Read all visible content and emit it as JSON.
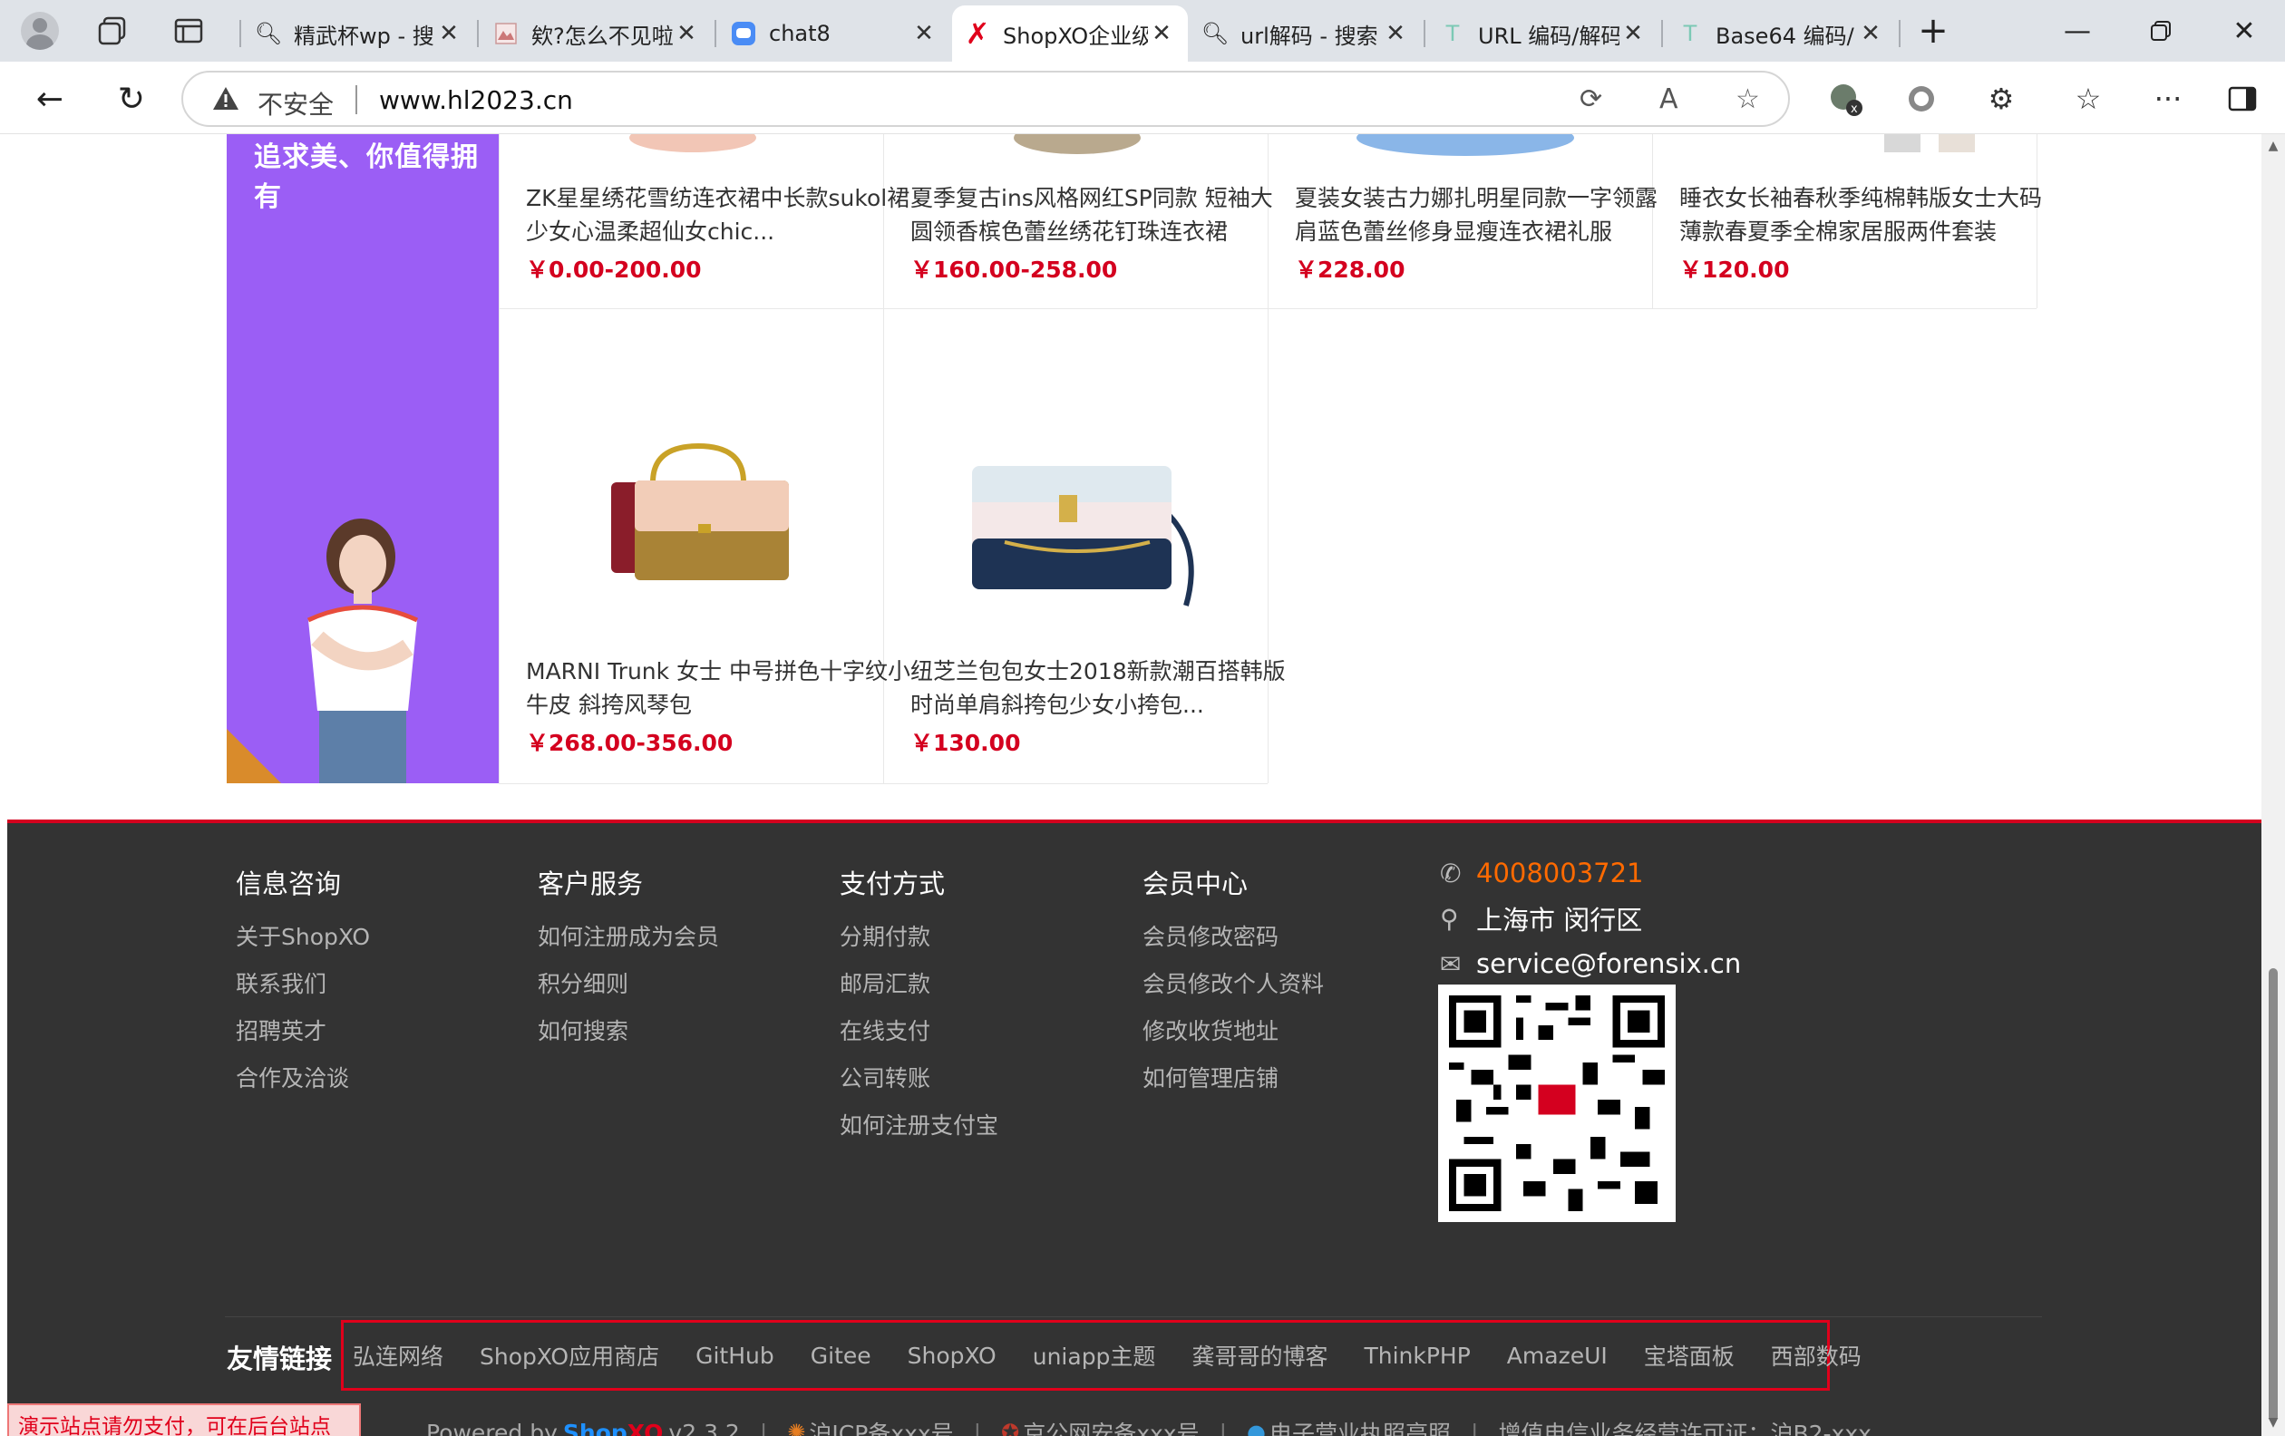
{
  "tabs": [
    {
      "title": "精武杯wp - 搜索",
      "icon": "search-icon",
      "active": false
    },
    {
      "title": "欸?怎么不见啦",
      "icon": "image-icon",
      "active": false
    },
    {
      "title": "chat8",
      "icon": "chat-icon",
      "active": false
    },
    {
      "title": "ShopXO企业级",
      "icon": "shopxo-icon",
      "active": true
    },
    {
      "title": "url解码 - 搜索",
      "icon": "search-icon",
      "active": false
    },
    {
      "title": "URL 编码/解码",
      "icon": "tool-icon",
      "active": false
    },
    {
      "title": "Base64 编码/",
      "icon": "tool-icon",
      "active": false
    }
  ],
  "address": {
    "insecure": "不安全",
    "url": "www.hl2023.cn"
  },
  "promo": {
    "text": "追求美、你值得拥有"
  },
  "products": [
    {
      "name": "ZK星星绣花雪纺连衣裙中长款sukol裙少女心温柔超仙女chic...",
      "price": "￥0.00-200.00"
    },
    {
      "name": "夏季复古ins风格网红SP同款 短袖大圆领香槟色蕾丝绣花钉珠连衣裙",
      "price": "￥160.00-258.00"
    },
    {
      "name": "夏装女装古力娜扎明星同款一字领露肩蓝色蕾丝修身显瘦连衣裙礼服",
      "price": "￥228.00"
    },
    {
      "name": "睡衣女长袖春秋季纯棉韩版女士大码薄款春夏季全棉家居服两件套装",
      "price": "￥120.00"
    },
    {
      "name": "MARNI Trunk 女士 中号拼色十字纹小牛皮 斜挎风琴包",
      "price": "￥268.00-356.00"
    },
    {
      "name": "纽芝兰包包女士2018新款潮百搭韩版时尚单肩斜挎包少女小挎包...",
      "price": "￥130.00"
    }
  ],
  "footer": {
    "columns": [
      {
        "title": "信息咨询",
        "links": [
          "关于ShopXO",
          "联系我们",
          "招聘英才",
          "合作及洽谈"
        ]
      },
      {
        "title": "客户服务",
        "links": [
          "如何注册成为会员",
          "积分细则",
          "如何搜索"
        ]
      },
      {
        "title": "支付方式",
        "links": [
          "分期付款",
          "邮局汇款",
          "在线支付",
          "公司转账",
          "如何注册支付宝"
        ]
      },
      {
        "title": "会员中心",
        "links": [
          "会员修改密码",
          "会员修改个人资料",
          "修改收货地址",
          "如何管理店铺"
        ]
      }
    ],
    "contact": {
      "phone": "4008003721",
      "address": "上海市 闵行区",
      "email": "service@forensix.cn"
    },
    "friend_links_label": "友情链接",
    "friend_links": [
      "弘连网络",
      "ShopXO应用商店",
      "GitHub",
      "Gitee",
      "ShopXO",
      "uniapp主题",
      "龚哥哥的博客",
      "ThinkPHP",
      "AmazeUI",
      "宝塔面板",
      "西部数码"
    ],
    "demo_note": "演示站点请勿支付，可在后台站点配置->基础配置(底部代码)修改",
    "powered_prefix": "Powered by",
    "brand_shop": "Shop",
    "brand_xo": "XO",
    "version": "v2.3.2",
    "icp": "沪ICP备xxx号",
    "police": "京公网安备xxx号",
    "license": "电子营业执照亮照",
    "telecom": "增值电信业务经营许可证：沪B2-xxx"
  }
}
